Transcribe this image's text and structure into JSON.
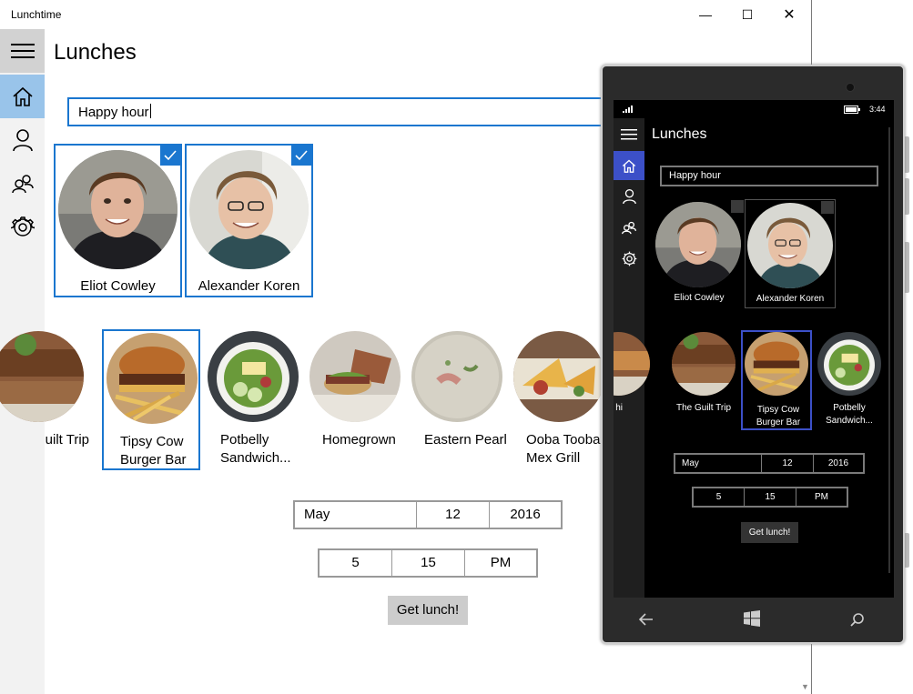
{
  "window": {
    "title": "Lunchtime",
    "controls": {
      "minimize": "—",
      "maximize": "☐",
      "close": "✕"
    }
  },
  "nav": {
    "items": [
      {
        "icon": "hamburger-menu-icon"
      },
      {
        "icon": "home-icon",
        "selected": true
      },
      {
        "icon": "person-icon"
      },
      {
        "icon": "group-icon"
      },
      {
        "icon": "gear-icon"
      }
    ]
  },
  "page": {
    "title": "Lunches"
  },
  "search": {
    "value": "Happy hour"
  },
  "people": [
    {
      "name": "Eliot Cowley",
      "selected": true
    },
    {
      "name": "Alexander Koren",
      "selected": true
    }
  ],
  "restaurants": [
    {
      "label": "uilt Trip",
      "selected": false
    },
    {
      "label": "Tipsy Cow Burger Bar",
      "selected": true
    },
    {
      "label": "Potbelly Sandwich...",
      "selected": false
    },
    {
      "label": "Homegrown",
      "selected": false
    },
    {
      "label": "Eastern Pearl",
      "selected": false
    },
    {
      "label": "Ooba Tooba Mex Grill",
      "selected": false
    }
  ],
  "date": {
    "month": "May",
    "day": "12",
    "year": "2016"
  },
  "time": {
    "hour": "5",
    "minute": "15",
    "ampm": "PM"
  },
  "action": {
    "label": "Get lunch!"
  },
  "phone": {
    "status": {
      "time": "3:44"
    },
    "title": "Lunches",
    "search_value": "Happy hour",
    "people": [
      {
        "name": "Eliot Cowley"
      },
      {
        "name": "Alexander Koren"
      }
    ],
    "restaurants": [
      {
        "label": "hi"
      },
      {
        "label": "The Guilt Trip"
      },
      {
        "label": "Tipsy Cow Burger Bar",
        "selected": true
      },
      {
        "label": "Potbelly Sandwich..."
      }
    ],
    "date": {
      "month": "May",
      "day": "12",
      "year": "2016"
    },
    "time": {
      "hour": "5",
      "minute": "15",
      "ampm": "PM"
    },
    "action_label": "Get lunch!"
  },
  "colors": {
    "accent": "#1a76cf",
    "phone_accent": "#3c50c8",
    "rail_bg": "#f2f2f2",
    "rail_selected": "#99c4ea",
    "button_bg": "#cccccc"
  }
}
